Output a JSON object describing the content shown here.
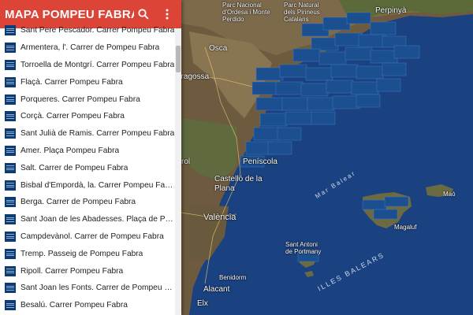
{
  "header": {
    "title": "MAPA POMPEU FABRA"
  },
  "sidebar": {
    "items": [
      {
        "label": "Sant Pere Pescador. Carrer Pompeu Fabra"
      },
      {
        "label": "Armentera, l'. Carrer de Pompeu Fabra"
      },
      {
        "label": "Torroella de Montgrí. Carrer Pompeu Fabra"
      },
      {
        "label": "Flaçà. Carrer Pompeu Fabra"
      },
      {
        "label": "Porqueres. Carrer Pompeu Fabra"
      },
      {
        "label": "Corçà. Carrer Pompeu Fabra"
      },
      {
        "label": "Sant Julià de Ramis. Carrer Pompeu Fabra"
      },
      {
        "label": "Amer. Plaça Pompeu Fabra"
      },
      {
        "label": "Salt. Carrer de Pompeu Fabra"
      },
      {
        "label": "Bisbal d'Empordà, la. Carrer Pompeu Fabra"
      },
      {
        "label": "Berga. Carrer de Pompeu Fabra"
      },
      {
        "label": "Sant Joan de les Abadesses. Plaça de Pompeu Fabra"
      },
      {
        "label": "Campdevànol. Carrer de Pompeu Fabra"
      },
      {
        "label": "Tremp. Passeig de Pompeu Fabra"
      },
      {
        "label": "Ripoll. Carrer Pompeu Fabra"
      },
      {
        "label": "Sant Joan les Fonts. Carrer de Pompeu Fabra"
      },
      {
        "label": "Besalú. Carrer Pompeu Fabra"
      }
    ]
  },
  "map": {
    "places": {
      "perpinya": "Perpinyà",
      "osca": "Osca",
      "saragossa": "aragossa",
      "castello": "Castelló de la Plana",
      "peniscola": "Peníscola",
      "valencia": "València",
      "benidorm": "Benidorm",
      "alacant": "Alacant",
      "elx": "Elx",
      "sant_antoni": "Sant Antoni de Portmany",
      "mao": "Maó",
      "magaluf": "Magaluf",
      "park": "Parc Nacional d'Ordesa i Monte Perdido",
      "pyrenees": "Parc Natural dels Pirineus Catalans",
      "teruel": "rol",
      "mar": "Mar Balear",
      "illes": "ILLES BALEARS"
    }
  },
  "colors": {
    "header": "#db4437",
    "sea": "#1a3f7a",
    "land": "#6b5a3e",
    "marker": "#1c4f8f"
  }
}
